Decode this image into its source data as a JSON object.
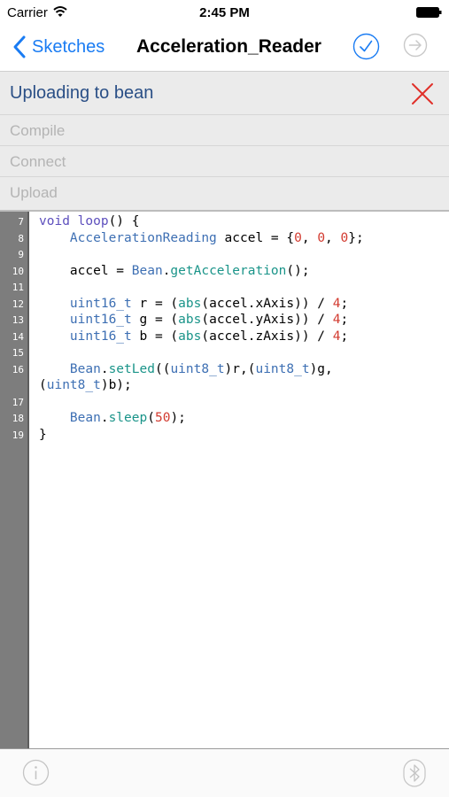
{
  "status_bar": {
    "carrier": "Carrier",
    "time": "2:45 PM"
  },
  "nav": {
    "back_label": "Sketches",
    "title": "Acceleration_Reader",
    "accent": "#1a7cf3"
  },
  "upload": {
    "title": "Uploading to bean",
    "steps": [
      "Compile",
      "Connect",
      "Upload"
    ],
    "close_color": "#e0302a"
  },
  "editor": {
    "line_numbers": [
      "7",
      "8",
      "9",
      "10",
      "11",
      "12",
      "13",
      "14",
      "15",
      "16",
      "17",
      "18",
      "19"
    ],
    "code": [
      [
        {
          "t": "void",
          "c": "kw"
        },
        {
          "t": " "
        },
        {
          "t": "loop",
          "c": "kw"
        },
        {
          "t": "() {"
        }
      ],
      [
        {
          "t": "    "
        },
        {
          "t": "AccelerationReading",
          "c": "ty"
        },
        {
          "t": " accel = {"
        },
        {
          "t": "0",
          "c": "num"
        },
        {
          "t": ", "
        },
        {
          "t": "0",
          "c": "num"
        },
        {
          "t": ", "
        },
        {
          "t": "0",
          "c": "num"
        },
        {
          "t": "};"
        }
      ],
      [],
      [
        {
          "t": "    accel = "
        },
        {
          "t": "Bean",
          "c": "ty"
        },
        {
          "t": "."
        },
        {
          "t": "getAcceleration",
          "c": "fn"
        },
        {
          "t": "();"
        }
      ],
      [],
      [
        {
          "t": "    "
        },
        {
          "t": "uint16_t",
          "c": "ty"
        },
        {
          "t": " r = ("
        },
        {
          "t": "abs",
          "c": "fn"
        },
        {
          "t": "(accel.xAxis)) / "
        },
        {
          "t": "4",
          "c": "num"
        },
        {
          "t": ";"
        }
      ],
      [
        {
          "t": "    "
        },
        {
          "t": "uint16_t",
          "c": "ty"
        },
        {
          "t": " g = ("
        },
        {
          "t": "abs",
          "c": "fn"
        },
        {
          "t": "(accel.yAxis)) / "
        },
        {
          "t": "4",
          "c": "num"
        },
        {
          "t": ";"
        }
      ],
      [
        {
          "t": "    "
        },
        {
          "t": "uint16_t",
          "c": "ty"
        },
        {
          "t": " b = ("
        },
        {
          "t": "abs",
          "c": "fn"
        },
        {
          "t": "(accel.zAxis)) / "
        },
        {
          "t": "4",
          "c": "num"
        },
        {
          "t": ";"
        }
      ],
      [],
      [
        {
          "t": "    "
        },
        {
          "t": "Bean",
          "c": "ty"
        },
        {
          "t": "."
        },
        {
          "t": "setLed",
          "c": "fn"
        },
        {
          "t": "(("
        },
        {
          "t": "uint8_t",
          "c": "ty"
        },
        {
          "t": ")r,("
        },
        {
          "t": "uint8_t",
          "c": "ty"
        },
        {
          "t": ")g,"
        }
      ],
      [
        {
          "t": "("
        },
        {
          "t": "uint8_t",
          "c": "ty"
        },
        {
          "t": ")b);"
        }
      ],
      [],
      [
        {
          "t": "    "
        },
        {
          "t": "Bean",
          "c": "ty"
        },
        {
          "t": "."
        },
        {
          "t": "sleep",
          "c": "fn"
        },
        {
          "t": "("
        },
        {
          "t": "50",
          "c": "num"
        },
        {
          "t": ");"
        }
      ],
      [
        {
          "t": "}"
        }
      ]
    ]
  },
  "toolbar": {
    "info_icon": "info-icon",
    "bluetooth_icon": "bluetooth-icon"
  }
}
